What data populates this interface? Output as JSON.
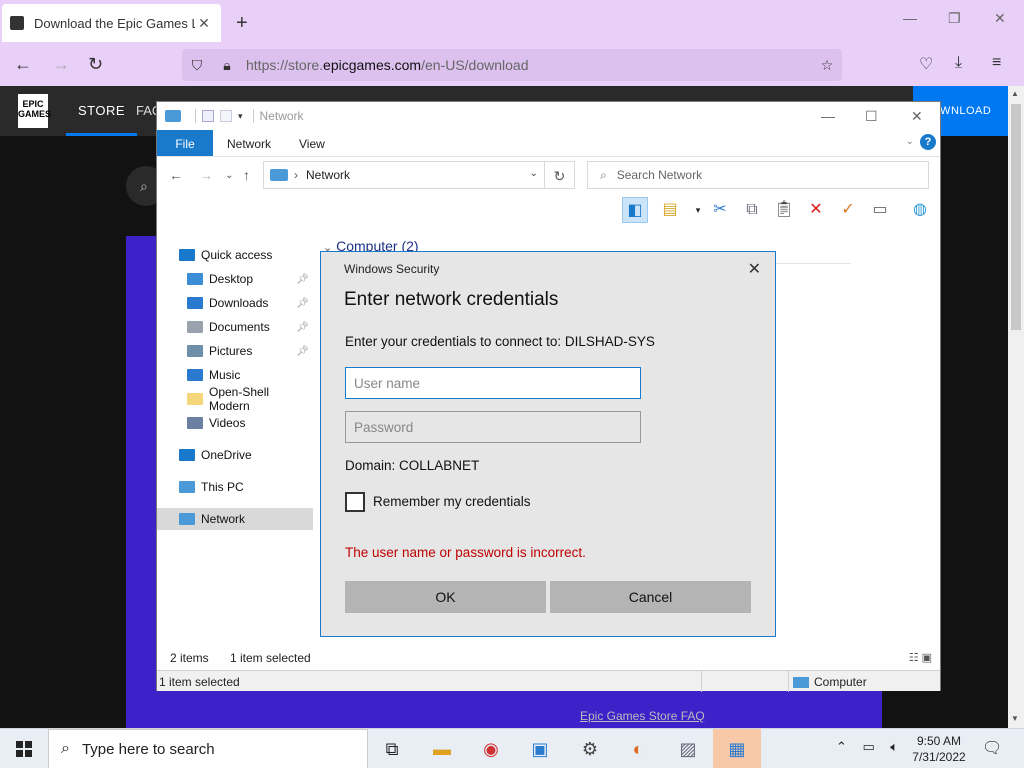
{
  "browser": {
    "tab_title": "Download the Epic Games Launcher",
    "new_tab": "+",
    "url_host": "https://store.",
    "url_domain": "epicgames.com",
    "url_path": "/en-US/download"
  },
  "epic": {
    "logo_text": "EPIC GAMES",
    "store_label": "STORE",
    "faq_label": "FAQ",
    "download_label": "OWNLOAD",
    "faq_link": "Epic Games Store FAQ"
  },
  "explorer": {
    "title": "Network",
    "ribbon_tabs": [
      "File",
      "Network",
      "View"
    ],
    "address": "Network",
    "search_placeholder": "Search Network",
    "nav_items": [
      {
        "label": "Quick access",
        "pinned": false,
        "color": "#1979ca"
      },
      {
        "label": "Desktop",
        "pinned": true,
        "color": "#3b8ed6"
      },
      {
        "label": "Downloads",
        "pinned": true,
        "color": "#2a7bd0"
      },
      {
        "label": "Documents",
        "pinned": true,
        "color": "#9aa3ad"
      },
      {
        "label": "Pictures",
        "pinned": true,
        "color": "#6f8fa8"
      },
      {
        "label": "Music",
        "pinned": false,
        "color": "#2a7bd0"
      },
      {
        "label": "Open-Shell Modern",
        "pinned": false,
        "color": "#f5d67a"
      },
      {
        "label": "Videos",
        "pinned": false,
        "color": "#6b7fa0"
      },
      {
        "label": "OneDrive",
        "pinned": false,
        "color": "#1979ca"
      },
      {
        "label": "This PC",
        "pinned": false,
        "color": "#4a9ad8"
      },
      {
        "label": "Network",
        "pinned": false,
        "color": "#4a9ad8"
      }
    ],
    "group_header": "Computer (2)",
    "items_count": "2 items",
    "selected_count": "1 item selected",
    "statusbar_left": "1 item selected",
    "statusbar_right": "Computer"
  },
  "dialog": {
    "header": "Windows Security",
    "title": "Enter network credentials",
    "message": "Enter your credentials to connect to: DILSHAD-SYS",
    "username_placeholder": "User name",
    "password_placeholder": "Password",
    "domain": "Domain: COLLABNET",
    "remember_label": "Remember my credentials",
    "remember_checked": false,
    "error": "The user name or password is incorrect.",
    "ok_label": "OK",
    "cancel_label": "Cancel"
  },
  "taskbar": {
    "search_placeholder": "Type here to search",
    "time": "9:50 AM",
    "date": "7/31/2022"
  }
}
